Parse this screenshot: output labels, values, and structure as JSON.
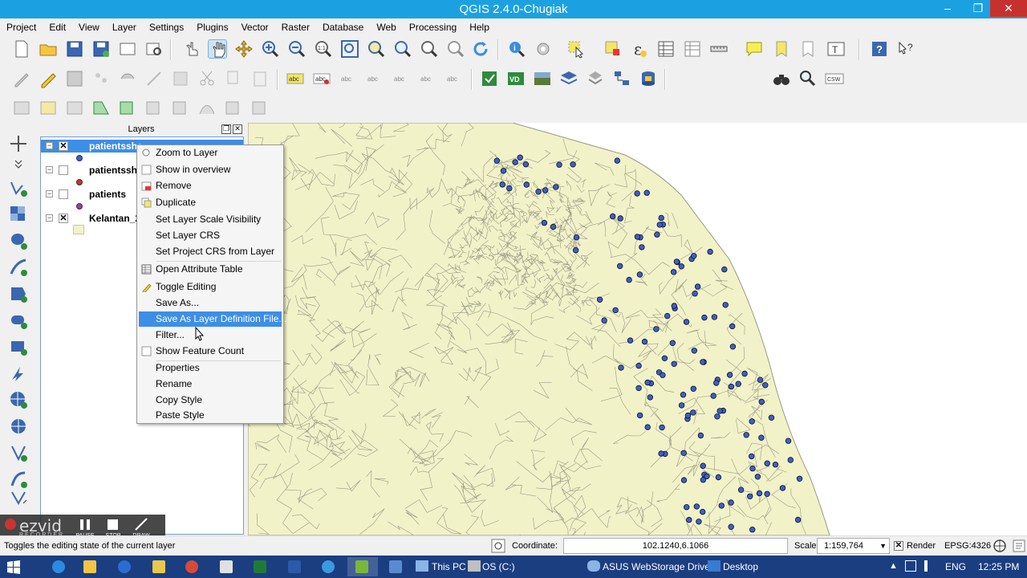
{
  "window": {
    "title": "QGIS 2.4.0-Chugiak",
    "minimize": "–",
    "maximize": "❐",
    "close": "✕"
  },
  "menubar": [
    "Project",
    "Edit",
    "View",
    "Layer",
    "Settings",
    "Plugins",
    "Vector",
    "Raster",
    "Database",
    "Web",
    "Processing",
    "Help"
  ],
  "layers_panel": {
    "title": "Layers",
    "layers": [
      {
        "name": "patientssha",
        "checked": true,
        "symbol_color": "#3c5fd0",
        "selected": true
      },
      {
        "name": "patientssha",
        "checked": false,
        "symbol_color": "#d0322a",
        "selected": false
      },
      {
        "name": "patients",
        "checked": false,
        "symbol_color": "#9a3fb5",
        "selected": false
      },
      {
        "name": "Kelantan_2",
        "checked": true,
        "symbol_color": "#f2f2c9",
        "selected": false
      }
    ]
  },
  "context_menu": {
    "items": [
      {
        "label": "Zoom to Layer",
        "icon": "zoom-icon"
      },
      {
        "label": "Show in overview",
        "icon": "checkbox-icon"
      },
      {
        "label": "Remove",
        "icon": "remove-icon"
      },
      {
        "label": "Duplicate",
        "icon": "duplicate-icon"
      },
      {
        "label": "Set Layer Scale Visibility",
        "icon": ""
      },
      {
        "label": "Set Layer CRS",
        "icon": ""
      },
      {
        "label": "Set Project CRS from Layer",
        "icon": ""
      },
      {
        "label": "Open Attribute Table",
        "icon": "table-icon"
      },
      {
        "label": "Toggle Editing",
        "icon": "pencil-icon"
      },
      {
        "label": "Save As...",
        "icon": ""
      },
      {
        "label": "Save As Layer Definition File...",
        "icon": "",
        "highlighted": true
      },
      {
        "label": "Filter...",
        "icon": ""
      },
      {
        "label": "Show Feature Count",
        "icon": "checkbox-icon"
      },
      {
        "label": "Properties",
        "icon": ""
      },
      {
        "label": "Rename",
        "icon": ""
      },
      {
        "label": "Copy Style",
        "icon": ""
      },
      {
        "label": "Paste Style",
        "icon": ""
      }
    ]
  },
  "recorder": {
    "brand": "ezvid",
    "sub": "RECORDER",
    "buttons": [
      "PAUSE",
      "STOP",
      "DRAW"
    ]
  },
  "statusbar": {
    "message": "Toggles the editing state of the current layer",
    "coordinate_label": "Coordinate:",
    "coordinate_value": "102.1240,6.1066",
    "scale_label": "Scale",
    "scale_value": "1:159,764",
    "render_label": "Render",
    "crs": "EPSG:4326"
  },
  "taskbar": {
    "drives": [
      "This PC",
      "OS (C:)"
    ],
    "storage": "ASUS WebStorage Drive",
    "desktop": "Desktop",
    "language": "ENG",
    "time": "12:25 PM"
  },
  "colors": {
    "titlebar": "#1ba1e2",
    "map_fill": "#f2f2c9",
    "map_border": "#999a85",
    "point_fill": "#3c5fd0",
    "highlight": "#3d8ee6",
    "taskbar": "#1b3e80"
  }
}
